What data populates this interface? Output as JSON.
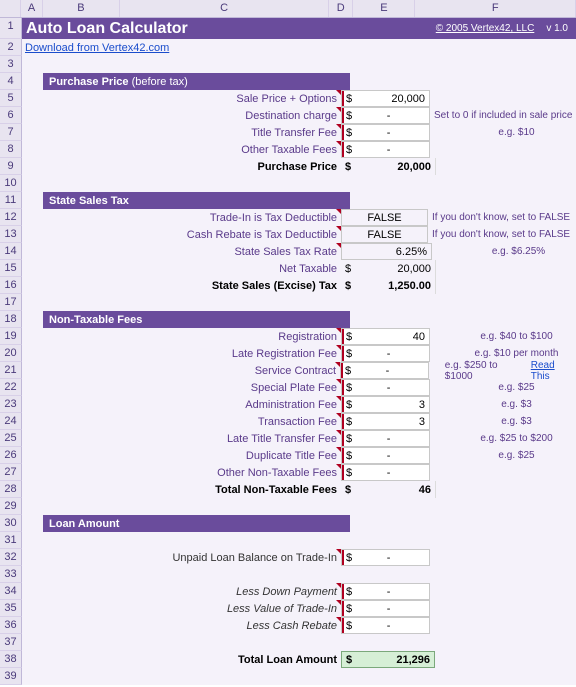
{
  "columns": [
    "A",
    "B",
    "C",
    "D",
    "E",
    "F"
  ],
  "rows": [
    "1",
    "2",
    "3",
    "4",
    "5",
    "6",
    "7",
    "8",
    "9",
    "10",
    "11",
    "12",
    "13",
    "14",
    "15",
    "16",
    "17",
    "18",
    "19",
    "20",
    "21",
    "22",
    "23",
    "24",
    "25",
    "26",
    "27",
    "28",
    "29",
    "30",
    "31",
    "32",
    "33",
    "34",
    "35",
    "36",
    "37",
    "38",
    "39"
  ],
  "title": "Auto Loan Calculator",
  "copyright": "© 2005 Vertex42, LLC",
  "version": "v 1.0",
  "download_link": "Download from Vertex42.com",
  "sections": {
    "purchase": {
      "header": "Purchase Price",
      "header_paren": "(before tax)",
      "rows": [
        {
          "label": "Sale Price + Options",
          "cur": "$",
          "val": "20,000",
          "hint": ""
        },
        {
          "label": "Destination charge",
          "cur": "$",
          "val": "-",
          "hint": "Set to 0 if included in sale price"
        },
        {
          "label": "Title Transfer Fee",
          "cur": "$",
          "val": "-",
          "hint": "e.g. $10"
        },
        {
          "label": "Other Taxable Fees",
          "cur": "$",
          "val": "-",
          "hint": ""
        }
      ],
      "total_label": "Purchase Price",
      "total_cur": "$",
      "total_val": "20,000"
    },
    "tax": {
      "header": "State Sales Tax",
      "rows": [
        {
          "label": "Trade-In is Tax Deductible",
          "val": "FALSE",
          "hint": "If you don't know, set to FALSE"
        },
        {
          "label": "Cash Rebate is Tax Deductible",
          "val": "FALSE",
          "hint": "If you don't know, set to FALSE"
        },
        {
          "label": "State Sales Tax Rate",
          "val": "6.25%",
          "hint": "e.g. $6.25%"
        },
        {
          "label": "Net Taxable",
          "cur": "$",
          "val": "20,000",
          "hint": ""
        }
      ],
      "total_label": "State Sales (Excise) Tax",
      "total_cur": "$",
      "total_val": "1,250.00"
    },
    "fees": {
      "header": "Non-Taxable Fees",
      "rows": [
        {
          "label": "Registration",
          "cur": "$",
          "val": "40",
          "hint": "e.g. $40 to $100"
        },
        {
          "label": "Late Registration Fee",
          "cur": "$",
          "val": "-",
          "hint": "e.g. $10 per month"
        },
        {
          "label": "Service Contract",
          "cur": "$",
          "val": "-",
          "hint": "e.g. $250 to $1000",
          "link": "Read This"
        },
        {
          "label": "Special Plate Fee",
          "cur": "$",
          "val": "-",
          "hint": "e.g. $25"
        },
        {
          "label": "Administration Fee",
          "cur": "$",
          "val": "3",
          "hint": "e.g. $3"
        },
        {
          "label": "Transaction Fee",
          "cur": "$",
          "val": "3",
          "hint": "e.g. $3"
        },
        {
          "label": "Late Title Transfer Fee",
          "cur": "$",
          "val": "-",
          "hint": "e.g. $25 to $200"
        },
        {
          "label": "Duplicate Title Fee",
          "cur": "$",
          "val": "-",
          "hint": "e.g. $25"
        },
        {
          "label": "Other Non-Taxable Fees",
          "cur": "$",
          "val": "-",
          "hint": ""
        }
      ],
      "total_label": "Total Non-Taxable Fees",
      "total_cur": "$",
      "total_val": "46"
    },
    "loan": {
      "header": "Loan Amount",
      "unpaid_label": "Unpaid Loan Balance on Trade-In",
      "unpaid_cur": "$",
      "unpaid_val": "-",
      "less": [
        {
          "label": "Less Down Payment",
          "cur": "$",
          "val": "-"
        },
        {
          "label": "Less Value of Trade-In",
          "cur": "$",
          "val": "-"
        },
        {
          "label": "Less Cash Rebate",
          "cur": "$",
          "val": "-"
        }
      ],
      "total_label": "Total Loan Amount",
      "total_cur": "$",
      "total_val": "21,296"
    }
  }
}
